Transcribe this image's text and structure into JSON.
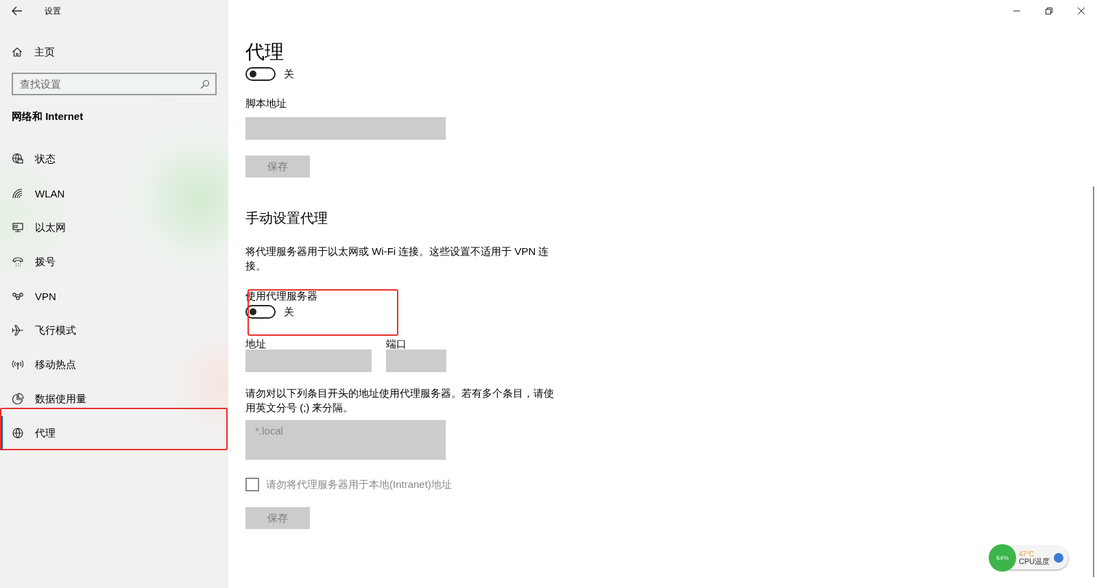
{
  "window": {
    "title": "设置"
  },
  "sidebar": {
    "home": "主页",
    "search": {
      "placeholder": "查找设置"
    },
    "section": "网络和 Internet",
    "items": [
      {
        "label": "状态",
        "kind": "status",
        "selected": false,
        "highlighted": false
      },
      {
        "label": "WLAN",
        "kind": "wlan",
        "selected": false,
        "highlighted": false
      },
      {
        "label": "以太网",
        "kind": "ethernet",
        "selected": false,
        "highlighted": false
      },
      {
        "label": "拨号",
        "kind": "dialup",
        "selected": false,
        "highlighted": false
      },
      {
        "label": "VPN",
        "kind": "vpn",
        "selected": false,
        "highlighted": false
      },
      {
        "label": "飞行模式",
        "kind": "airplane",
        "selected": false,
        "highlighted": false
      },
      {
        "label": "移动热点",
        "kind": "hotspot",
        "selected": false,
        "highlighted": false
      },
      {
        "label": "数据使用量",
        "kind": "datausage",
        "selected": false,
        "highlighted": false
      },
      {
        "label": "代理",
        "kind": "proxy",
        "selected": true,
        "highlighted": true
      }
    ]
  },
  "page": {
    "title": "代理",
    "auto_toggle": {
      "on": false,
      "state_label": "关"
    },
    "script_address": {
      "label": "脚本地址"
    },
    "script_save": "保存",
    "manual_heading": "手动设置代理",
    "manual_description": "将代理服务器用于以太网或 Wi-Fi 连接。这些设置不适用于 VPN 连接。",
    "use_proxy": {
      "label": "使用代理服务器",
      "on": false,
      "state_label": "关",
      "highlighted": true
    },
    "address": {
      "label": "地址"
    },
    "port": {
      "label": "端口"
    },
    "exceptions_description": "请勿对以下列条目开头的地址使用代理服务器。若有多个条目，请使用英文分号 (;) 来分隔。",
    "exceptions": {
      "value": "*.local"
    },
    "local_checkbox": {
      "label": "请勿将代理服务器用于本地(Intranet)地址",
      "checked": false,
      "disabled": true
    },
    "manual_save": "保存"
  },
  "cpu_widget": {
    "usage": "64%",
    "temperature": "47°C",
    "label": "CPU温度"
  }
}
